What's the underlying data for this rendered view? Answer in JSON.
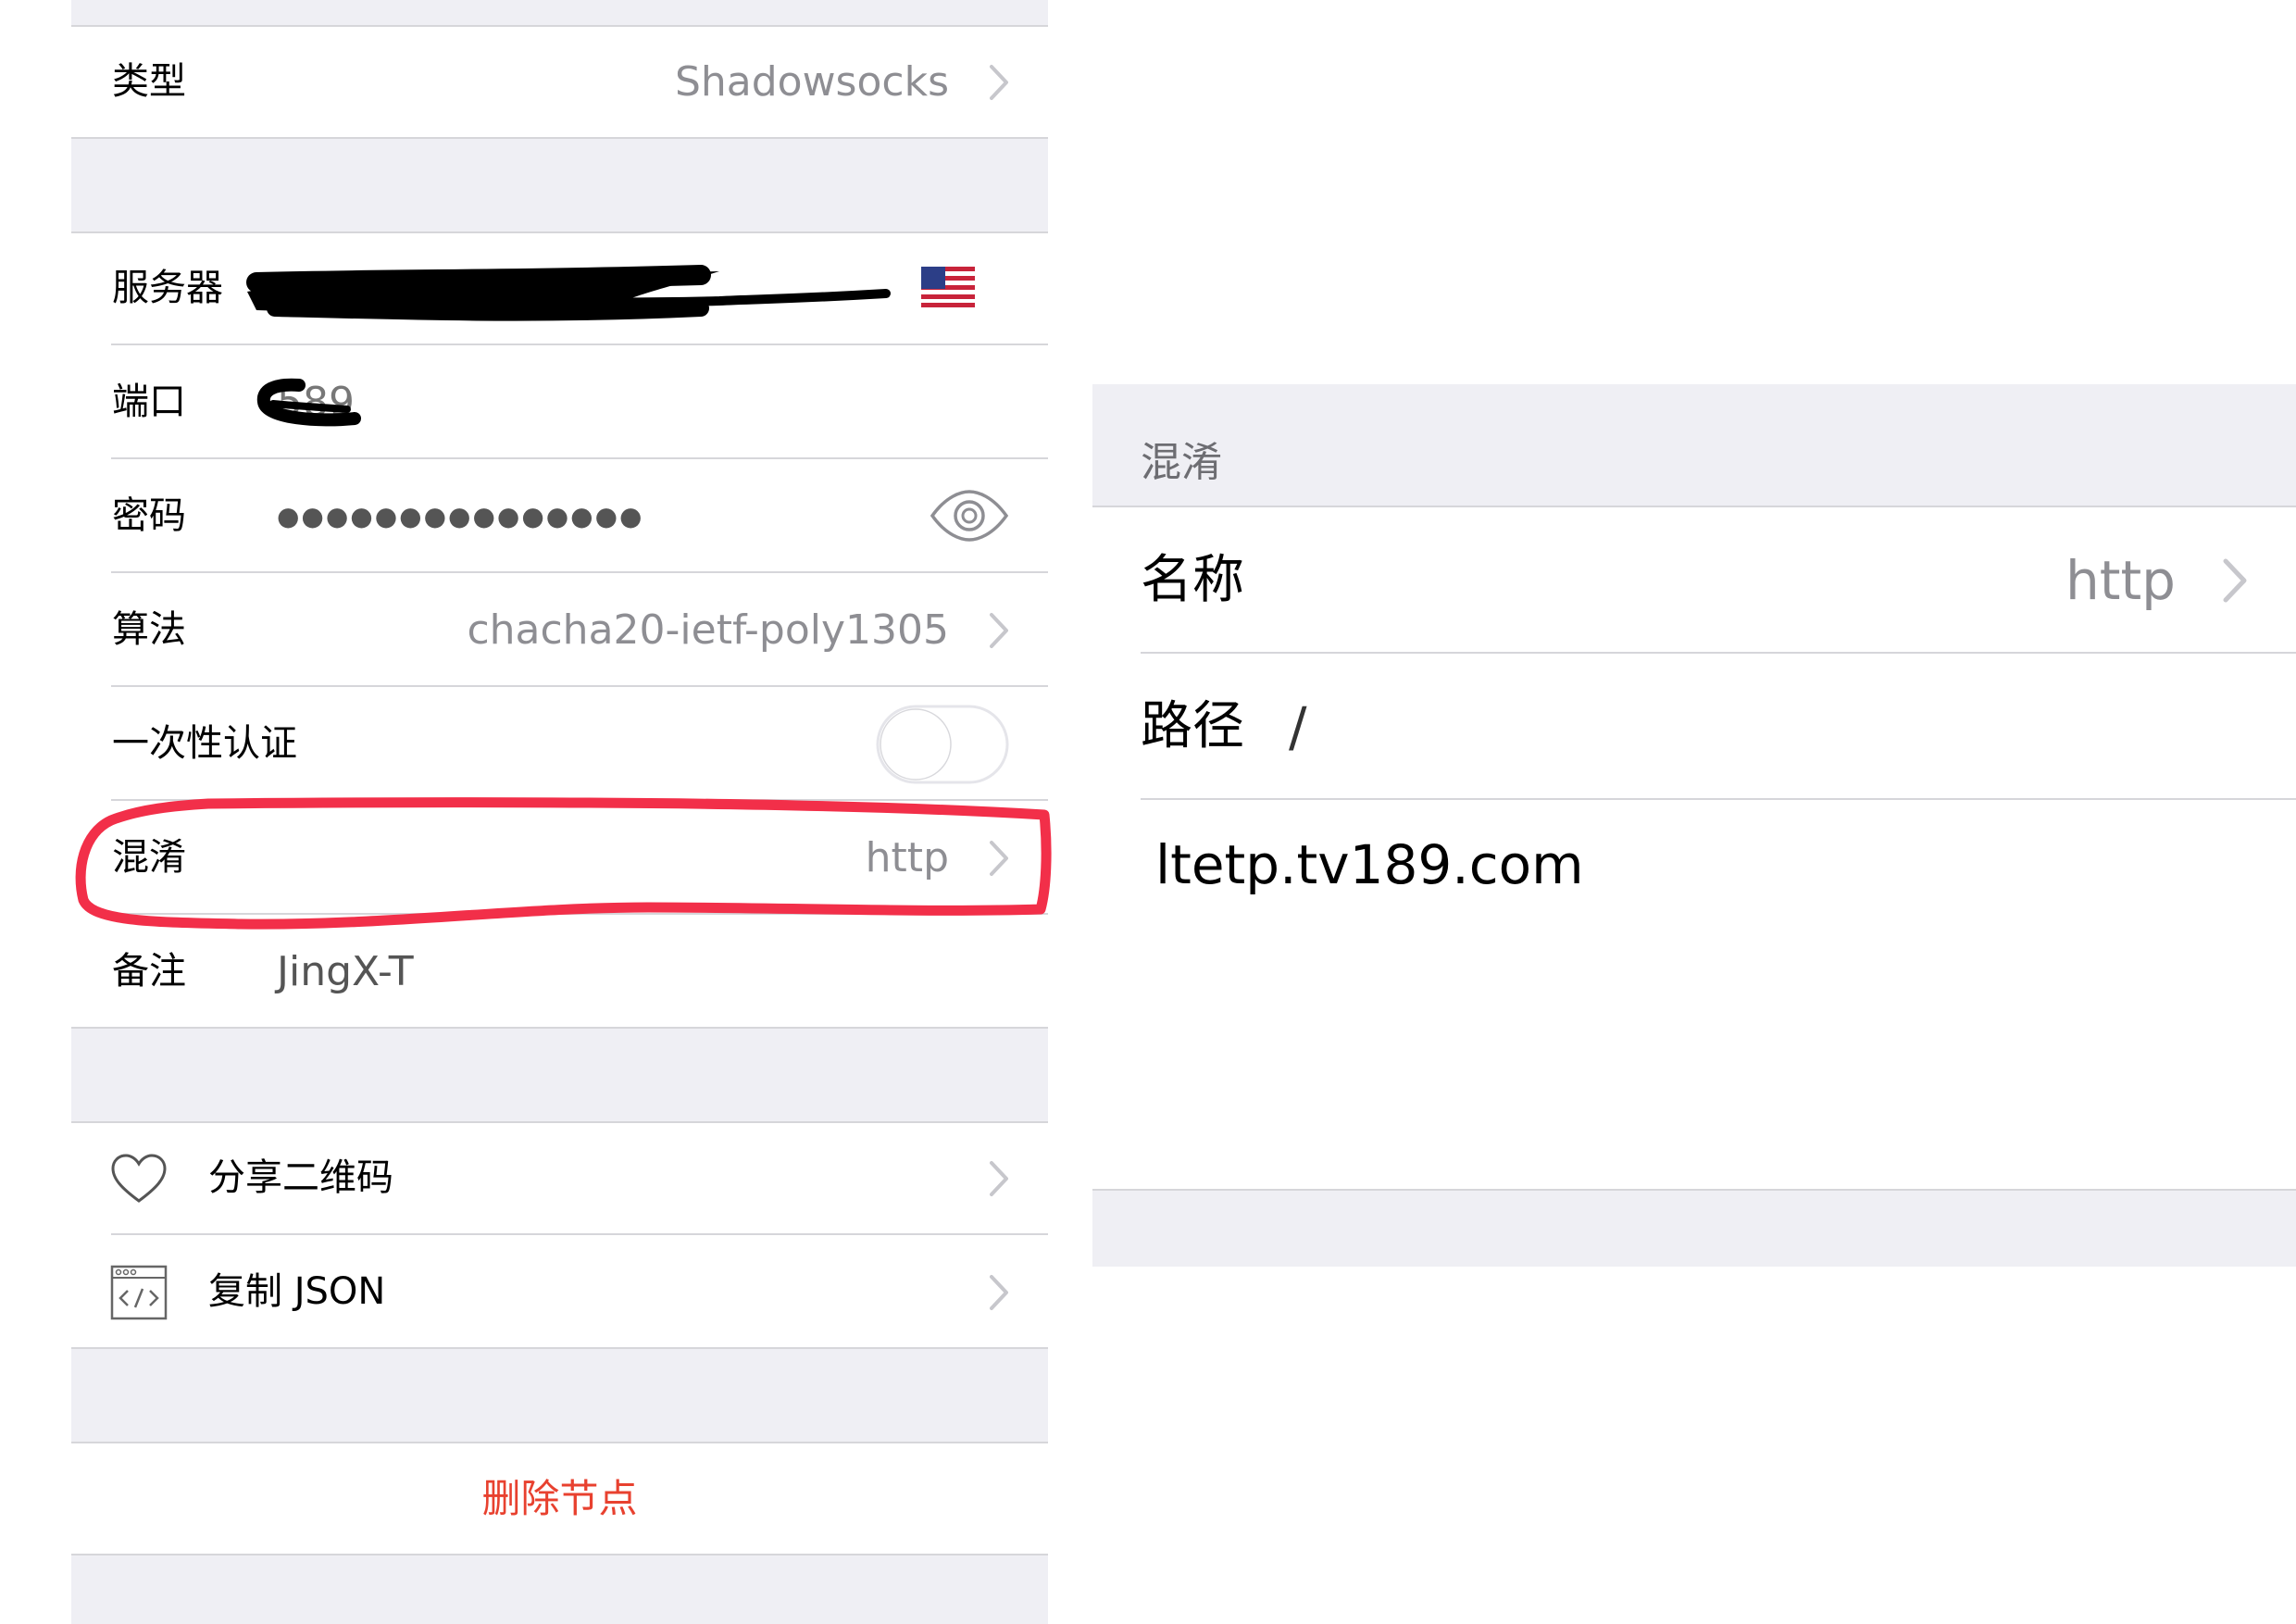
{
  "left": {
    "type_row": {
      "label": "类型",
      "value": "Shadowsocks"
    },
    "server_row": {
      "label": "服务器"
    },
    "port_row": {
      "label": "端口",
      "value": "589"
    },
    "password_row": {
      "label": "密码",
      "value": "●●●●●●●●●●●●●●●"
    },
    "method_row": {
      "label": "算法",
      "value": "chacha20-ietf-poly1305"
    },
    "ota_row": {
      "label": "一次性认证"
    },
    "obfs_row": {
      "label": "混淆",
      "value": "http"
    },
    "note_row": {
      "label": "备注",
      "value": "JingX-T"
    },
    "share_row": {
      "label": "分享二维码"
    },
    "copy_row": {
      "label": "复制 JSON"
    },
    "delete_row": {
      "label": "删除节点"
    }
  },
  "right": {
    "section_header": "混淆",
    "name_row": {
      "label": "名称",
      "value": "http"
    },
    "path_row": {
      "label": "路径",
      "value": "/"
    },
    "host_value": "ltetp.tv189.com"
  },
  "colors": {
    "group_background": "#efeff4",
    "secondary_text": "#8e8e93",
    "destructive": "#e8412f",
    "annotation": "#f22f49"
  },
  "icons": [
    "chevron-right-icon",
    "us-flag-icon",
    "eye-icon",
    "toggle-switch",
    "heart-icon",
    "code-window-icon"
  ]
}
